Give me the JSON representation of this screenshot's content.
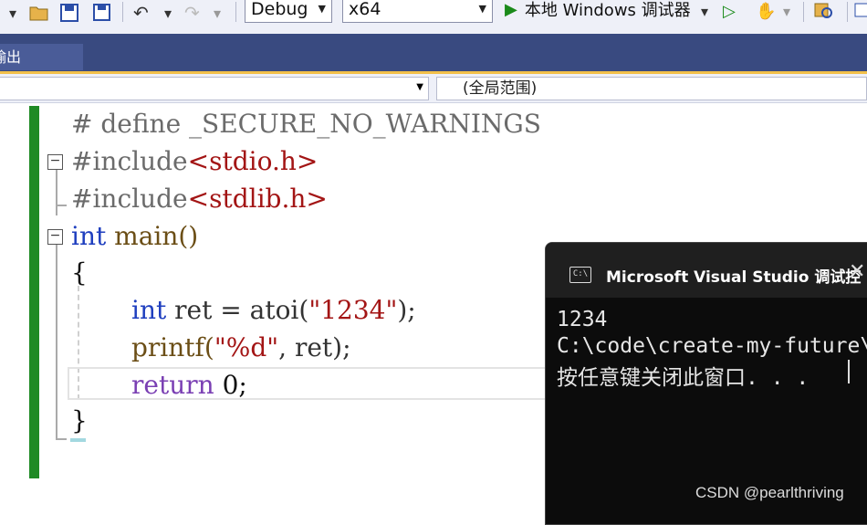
{
  "toolbar": {
    "config_value": "Debug",
    "platform_value": "x64",
    "run_label": "本地 Windows 调试器"
  },
  "tabbar": {
    "output_tab_label": "输出"
  },
  "navbar": {
    "scope_label": "(全局范围)"
  },
  "code": {
    "line1": "# define _SECURE_NO_WARNINGS",
    "line2_kw": "#include",
    "line2_hdr": "<stdio.h>",
    "line3_kw": "#include",
    "line3_hdr": "<stdlib.h>",
    "line4_type": "int",
    "line4_name": " main()",
    "line5": "{",
    "line6_type": "int",
    "line6_rest_a": " ret = atoi(",
    "line6_str": "\"1234\"",
    "line6_rest_b": ");",
    "line7_fn": "printf(",
    "line7_str": "\"%d\"",
    "line7_rest": ", ret);",
    "line8_kw": "return",
    "line8_rest": " 0;",
    "line9": "}"
  },
  "console": {
    "title": "Microsoft Visual Studio 调试控",
    "output_lines": [
      "1234",
      "C:\\code\\create-my-future\\",
      "按任意键关闭此窗口. . ."
    ]
  },
  "watermark": "CSDN @pearlthriving"
}
